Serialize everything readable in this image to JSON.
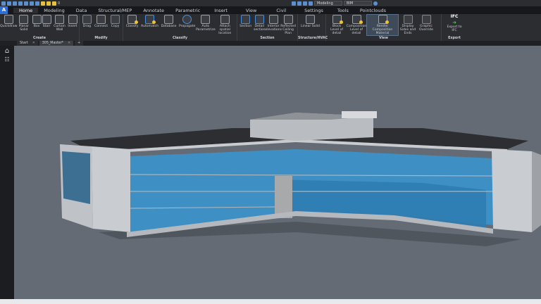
{
  "quick_access": {
    "layer_value": "0",
    "workspace": "Modeling",
    "mode": "BIM"
  },
  "menu_tabs": [
    "Home",
    "Modeling",
    "Data",
    "Structural/MEP",
    "Annotate",
    "Parametric",
    "Insert",
    "View",
    "Civil",
    "Settings",
    "Tools",
    "Pointclouds"
  ],
  "active_tab": "Home",
  "ribbon": [
    {
      "group": "Create",
      "buttons": [
        "Quickdraw",
        "Planar Solid",
        "Box",
        "Stair",
        "Curtain Wall",
        "Insert"
      ]
    },
    {
      "group": "Modify",
      "buttons": [
        "Drag",
        "Connect",
        "Copy"
      ]
    },
    {
      "group": "Classify",
      "buttons": [
        "Classify",
        "Automatch",
        "Database",
        "Propagate",
        "Auto Parametrize",
        "Attach spatial location"
      ]
    },
    {
      "group": "Section",
      "buttons": [
        "Section",
        "Detail section",
        "Interior elevations",
        "Reflected Ceiling Plan"
      ]
    },
    {
      "group": "Structure/HVAC",
      "buttons": [
        "Linear Solid"
      ]
    },
    {
      "group": "View",
      "buttons": [
        "Block Level of detail",
        "Composition Level of detail",
        "Render Composition Material",
        "Display Sides and Ends",
        "Graphic Override"
      ]
    },
    {
      "group": "Export",
      "buttons": [
        "Export to IFC"
      ],
      "badge": "IFC"
    }
  ],
  "doc_tabs": [
    {
      "label": "Start"
    },
    {
      "label": "305_Master*"
    }
  ],
  "colors": {
    "accent": "#2f6fd8",
    "viewport": "#646b74",
    "glass": "#3d8fc4"
  }
}
